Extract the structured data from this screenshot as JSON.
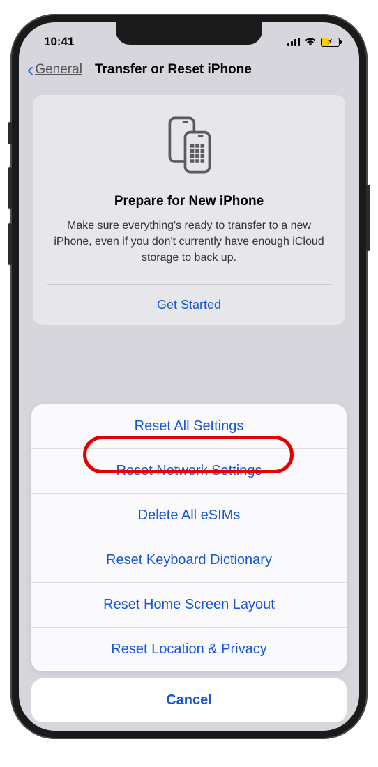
{
  "status": {
    "time": "10:41"
  },
  "nav": {
    "back_label": "General",
    "title": "Transfer or Reset iPhone"
  },
  "card": {
    "title": "Prepare for New iPhone",
    "description": "Make sure everything's ready to transfer to a new iPhone, even if you don't currently have enough iCloud storage to back up.",
    "get_started": "Get Started"
  },
  "sheet": {
    "items": [
      "Reset All Settings",
      "Reset Network Settings",
      "Delete All eSIMs",
      "Reset Keyboard Dictionary",
      "Reset Home Screen Layout",
      "Reset Location & Privacy"
    ],
    "cancel": "Cancel"
  },
  "hidden_row": "Reset"
}
